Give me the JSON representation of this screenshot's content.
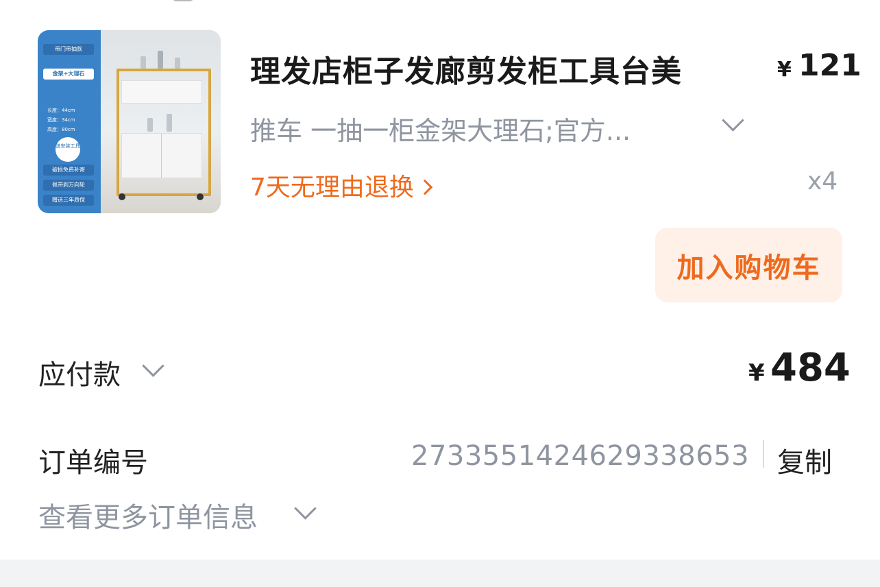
{
  "product": {
    "title": "理发店柜子发廊剪发柜工具台美",
    "price_unit": "¥",
    "price": "121",
    "spec": "推车 一抽一柜金架大理石;官方...",
    "return_policy": "7天无理由退换",
    "quantity": "x4",
    "image": {
      "tag_top": "带门带抽款",
      "tag_material": "金架+大理石",
      "spec_length": "长度：44cm",
      "spec_width": "宽度：34cm",
      "spec_height": "高度：80cm",
      "badge": "送安装工具",
      "promo_1": "破损免费补寄",
      "promo_2": "佩带刹万向轮",
      "promo_3": "赠送三年质保"
    }
  },
  "actions": {
    "add_to_cart": "加入购物车"
  },
  "payment": {
    "label": "应付款",
    "unit": "¥",
    "amount": "484"
  },
  "order": {
    "label": "订单编号",
    "number": "2733551424629338653",
    "copy_label": "复制",
    "more_label": "查看更多订单信息"
  },
  "colors": {
    "accent": "#ef6a1d",
    "accent_bg": "#fff0e8",
    "muted": "#8f95a0"
  }
}
